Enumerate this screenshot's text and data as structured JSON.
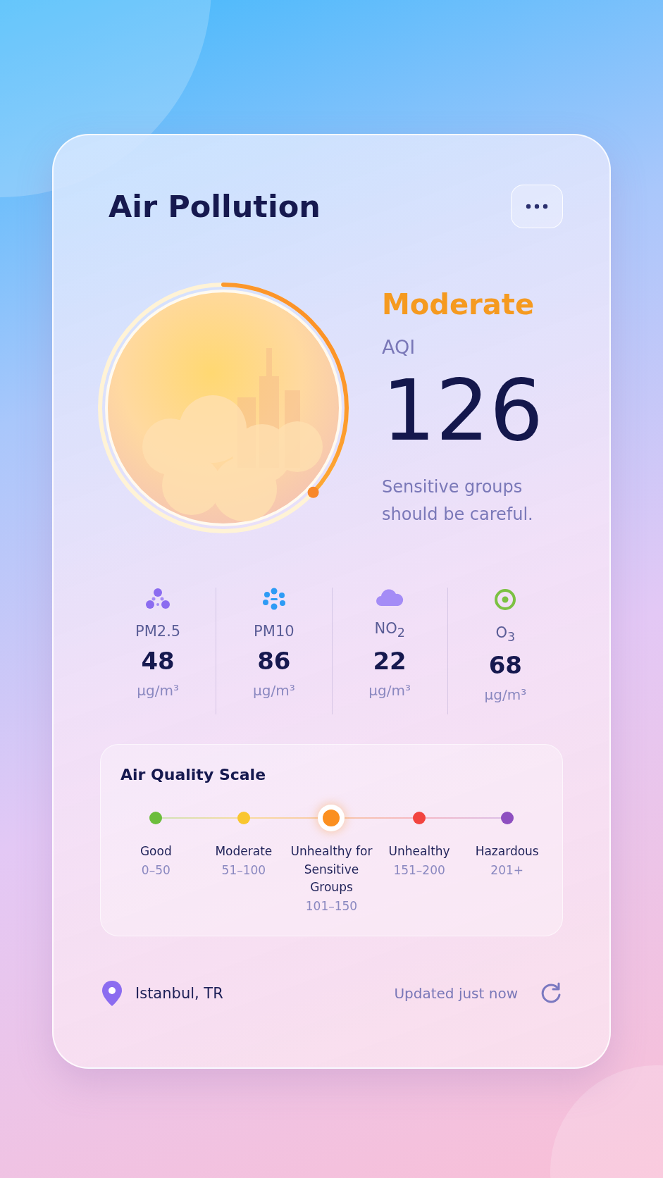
{
  "title": "Air Pollution",
  "summary": {
    "category": "Moderate",
    "label": "AQI",
    "value": "126",
    "advice": "Sensitive groups should be careful.",
    "level": 0.37
  },
  "pollutants": [
    {
      "kind": "pm25",
      "name": "PM2.5",
      "value": "48",
      "unit": "µg/m³"
    },
    {
      "kind": "pm10",
      "name": "PM10",
      "value": "86",
      "unit": "µg/m³"
    },
    {
      "kind": "no2",
      "name": "NO$_{2}$",
      "value": "22",
      "unit": "µg/m³"
    },
    {
      "kind": "o3",
      "name": "O$_{3}$",
      "value": "68",
      "unit": "µg/m³"
    }
  ],
  "scale": {
    "title": "Air Quality Scale",
    "levels": [
      {
        "name": "Good",
        "range": "0–50",
        "color": "#6cbd3c",
        "selected": false
      },
      {
        "name": "Moderate",
        "range": "51–100",
        "color": "#f9c62f",
        "selected": false
      },
      {
        "name": "Unhealthy for Sensitive Groups",
        "range": "101–150",
        "color": "#fb8f1f",
        "selected": true
      },
      {
        "name": "Unhealthy",
        "range": "151–200",
        "color": "#f2443f",
        "selected": false
      },
      {
        "name": "Hazardous",
        "range": "201+",
        "color": "#8e4fc0",
        "selected": false
      }
    ]
  },
  "footer": {
    "location": "Istanbul, TR",
    "updated": "Updated just now"
  }
}
